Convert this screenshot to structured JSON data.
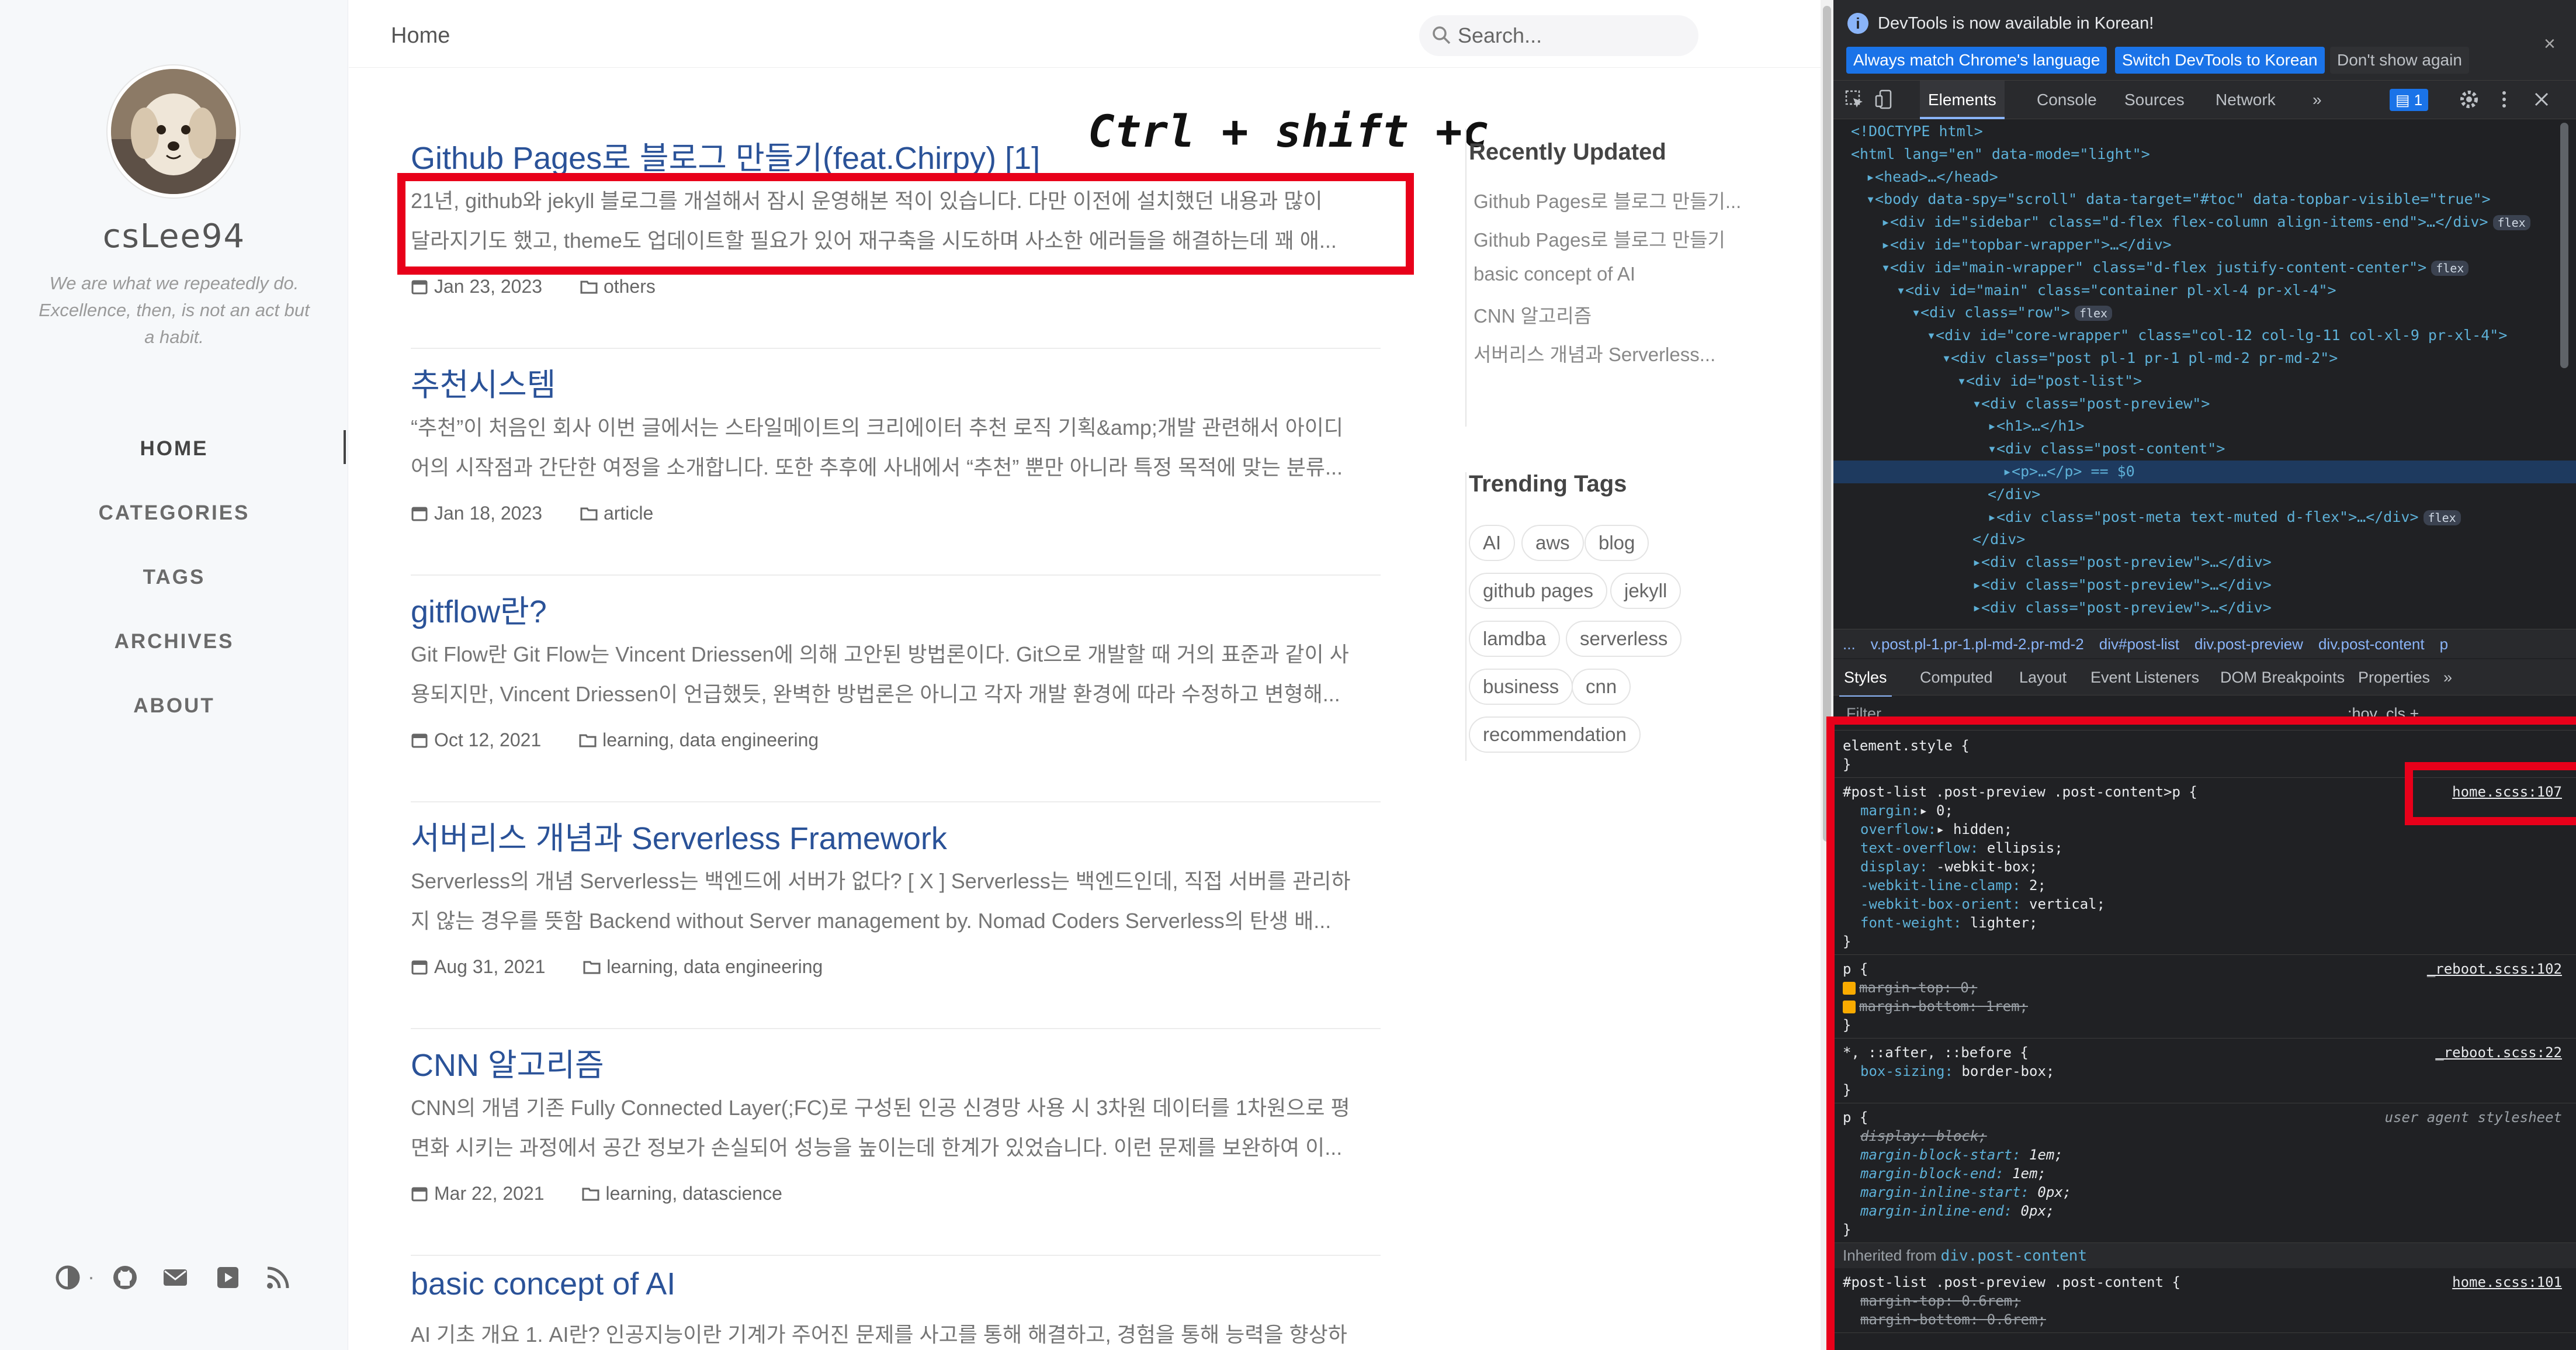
{
  "sidebar": {
    "site_title": "csLee94",
    "subtitle": "We are what we repeatedly do. Excellence, then, is not an act but a habit.",
    "nav": [
      "HOME",
      "CATEGORIES",
      "TAGS",
      "ARCHIVES",
      "ABOUT"
    ],
    "footer_icons": [
      "theme-toggle-icon",
      "github-icon",
      "mail-icon",
      "linkedin-icon",
      "rss-icon"
    ],
    "footer_separator": "·"
  },
  "topbar": {
    "breadcrumb": "Home",
    "search_placeholder": "Search..."
  },
  "posts": [
    {
      "title": "Github Pages로 블로그 만들기(feat.Chirpy) [1]",
      "excerpt": [
        "21년, github와 jekyll 블로그를 개설해서 잠시 운영해본 적이 있습니다. 다만 이전에 설치했던 내용과 많이",
        "달라지기도 했고, theme도 업데이트할 필요가 있어 재구축을 시도하며 사소한 에러들을 해결하는데 꽤 애..."
      ],
      "date": "Jan 23, 2023",
      "category": "others"
    },
    {
      "title": "추천시스템",
      "excerpt": [
        "“추천”이 처음인 회사 이번 글에서는 스타일메이트의 크리에이터 추천 로직 기획&amp;개발 관련해서 아이디",
        "어의 시작점과 간단한 여정을 소개합니다. 또한 추후에 사내에서 “추천” 뿐만 아니라 특정 목적에 맞는 분류..."
      ],
      "date": "Jan 18, 2023",
      "category": "article"
    },
    {
      "title": "gitflow란?",
      "excerpt": [
        "Git Flow란 Git Flow는 Vincent Driessen에 의해 고안된 방법론이다. Git으로 개발할 때 거의 표준과 같이 사",
        "용되지만, Vincent Driessen이 언급했듯, 완벽한 방법론은 아니고 각자 개발 환경에 따라 수정하고 변형해..."
      ],
      "date": "Oct 12, 2021",
      "category": "learning, data engineering"
    },
    {
      "title": "서버리스 개념과 Serverless Framework",
      "excerpt": [
        "Serverless의 개념 Serverless는 백엔드에 서버가 없다? [ X ] Serverless는 백엔드인데, 직접 서버를 관리하",
        "지 않는 경우를 뜻함 Backend without Server management by. Nomad Coders Serverless의 탄생 배..."
      ],
      "date": "Aug 31, 2021",
      "category": "learning, data engineering"
    },
    {
      "title": "CNN 알고리즘",
      "excerpt": [
        "CNN의 개념 기존 Fully Connected Layer(;FC)로 구성된 인공 신경망 사용 시 3차원 데이터를 1차원으로 평",
        "면화 시키는 과정에서 공간 정보가 손실되어 성능을 높이는데 한계가 있었습니다. 이런 문제를 보완하여 이..."
      ],
      "date": "Mar 22, 2021",
      "category": "learning, datascience"
    },
    {
      "title": "basic concept of AI",
      "excerpt": [
        "AI 기초 개요 1. AI란? 인공지능이란 기계가 주어진 문제를 사고를 통해 해결하고, 경험을 통해 능력을 향상하"
      ],
      "date": "",
      "category": ""
    }
  ],
  "recently_updated": {
    "heading": "Recently Updated",
    "items": [
      "Github Pages로 블로그 만들기...",
      "Github Pages로 블로그 만들기",
      "basic concept of AI",
      "CNN 알고리즘",
      "서버리스 개념과 Serverless..."
    ]
  },
  "trending_tags": {
    "heading": "Trending Tags",
    "tags": [
      "AI",
      "aws",
      "blog",
      "github pages",
      "jekyll",
      "lamdba",
      "serverless",
      "business",
      "cnn",
      "recommendation"
    ]
  },
  "annotation": {
    "shortcut": "Ctrl + shift +c"
  },
  "devtools": {
    "infobar": {
      "message": "DevTools is now available in Korean!",
      "buttons": [
        "Always match Chrome's language",
        "Switch DevTools to Korean",
        "Don't show again"
      ],
      "close": "×"
    },
    "tabs": [
      "Elements",
      "Console",
      "Sources",
      "Network",
      "»"
    ],
    "issues_count": "1",
    "dom_lines": [
      {
        "indent": 0,
        "html": "<!DOCTYPE html>"
      },
      {
        "indent": 0,
        "html": "<html lang=\"en\" data-mode=\"light\">"
      },
      {
        "indent": 1,
        "html": "▸<head>…</head>"
      },
      {
        "indent": 1,
        "html": "▾<body data-spy=\"scroll\" data-target=\"#toc\" data-topbar-visible=\"true\">"
      },
      {
        "indent": 2,
        "html": "▸<div id=\"sidebar\" class=\"d-flex flex-column align-items-end\">…</div>",
        "badge": "flex"
      },
      {
        "indent": 2,
        "html": "▸<div id=\"topbar-wrapper\">…</div>"
      },
      {
        "indent": 2,
        "html": "▾<div id=\"main-wrapper\" class=\"d-flex justify-content-center\">",
        "badge": "flex"
      },
      {
        "indent": 3,
        "html": "▾<div id=\"main\" class=\"container pl-xl-4 pr-xl-4\">"
      },
      {
        "indent": 4,
        "html": "▾<div class=\"row\">",
        "badge": "flex"
      },
      {
        "indent": 5,
        "html": "▾<div id=\"core-wrapper\" class=\"col-12 col-lg-11 col-xl-9 pr-xl-4\">"
      },
      {
        "indent": 6,
        "html": "▾<div class=\"post pl-1 pr-1 pl-md-2 pr-md-2\">"
      },
      {
        "indent": 7,
        "html": "▾<div id=\"post-list\">"
      },
      {
        "indent": 8,
        "html": "▾<div class=\"post-preview\">"
      },
      {
        "indent": 9,
        "html": "▸<h1>…</h1>"
      },
      {
        "indent": 9,
        "html": "▾<div class=\"post-content\">"
      },
      {
        "indent": 10,
        "html": "▸<p>…</p> == $0",
        "selected": true
      },
      {
        "indent": 9,
        "html": "</div>"
      },
      {
        "indent": 9,
        "html": "▸<div class=\"post-meta text-muted d-flex\">…</div>",
        "badge": "flex"
      },
      {
        "indent": 8,
        "html": "</div>"
      },
      {
        "indent": 8,
        "html": "▸<div class=\"post-preview\">…</div>"
      },
      {
        "indent": 8,
        "html": "▸<div class=\"post-preview\">…</div>"
      },
      {
        "indent": 8,
        "html": "▸<div class=\"post-preview\">…</div>"
      }
    ],
    "dom_breadcrumb": [
      "...",
      "v.post.pl-1.pr-1.pl-md-2.pr-md-2",
      "div#post-list",
      "div.post-preview",
      "div.post-content",
      "p"
    ],
    "style_tabs": [
      "Styles",
      "Computed",
      "Layout",
      "Event Listeners",
      "DOM Breakpoints",
      "Properties",
      "»"
    ],
    "filter_placeholder": "Filter",
    "filter_buttons": ":hov  .cls  +",
    "rules": [
      {
        "selector": "element.style {",
        "source": "",
        "props": [],
        "close": "}"
      },
      {
        "selector": "#post-list .post-preview .post-content>p {",
        "source": "home.scss:107",
        "props": [
          {
            "n": "margin",
            "v": "▸ 0;"
          },
          {
            "n": "overflow",
            "v": "▸ hidden;"
          },
          {
            "n": "text-overflow",
            "v": " ellipsis;"
          },
          {
            "n": "display",
            "v": " -webkit-box;"
          },
          {
            "n": "-webkit-line-clamp",
            "v": " 2;"
          },
          {
            "n": "-webkit-box-orient",
            "v": " vertical;"
          },
          {
            "n": "font-weight",
            "v": " lighter;"
          }
        ],
        "close": "}"
      },
      {
        "selector": "p {",
        "source": "_reboot.scss:102",
        "props": [
          {
            "n": "margin-top",
            "v": " 0;",
            "strike": true,
            "check": true
          },
          {
            "n": "margin-bottom",
            "v": " 1rem;",
            "strike": true,
            "check": true
          }
        ],
        "close": "}"
      },
      {
        "selector": "*, ::after, ::before {",
        "source": "_reboot.scss:22",
        "props": [
          {
            "n": "box-sizing",
            "v": " border-box;"
          }
        ],
        "close": "}"
      },
      {
        "selector": "p {",
        "source": "user agent stylesheet",
        "ua": true,
        "props": [
          {
            "n": "display",
            "v": " block;",
            "strike": true,
            "italic": true
          },
          {
            "n": "margin-block-start",
            "v": " 1em;",
            "italic": true
          },
          {
            "n": "margin-block-end",
            "v": " 1em;",
            "italic": true
          },
          {
            "n": "margin-inline-start",
            "v": " 0px;",
            "italic": true
          },
          {
            "n": "margin-inline-end",
            "v": " 0px;",
            "italic": true
          }
        ],
        "close": "}"
      }
    ],
    "inherited_label": "Inherited from",
    "inherited_from": "div.post-content",
    "last_rule": {
      "selector": "#post-list .post-preview .post-content {",
      "source": "home.scss:101",
      "props": [
        {
          "n": "margin-top",
          "v": " 0.6rem;",
          "strike": true
        },
        {
          "n": "margin-bottom",
          "v": " 0.6rem;",
          "strike": true
        }
      ]
    }
  },
  "colors": {
    "accent_link": "#2a5298",
    "annotation_red": "#e8001a",
    "devtools_bg": "#202124"
  }
}
